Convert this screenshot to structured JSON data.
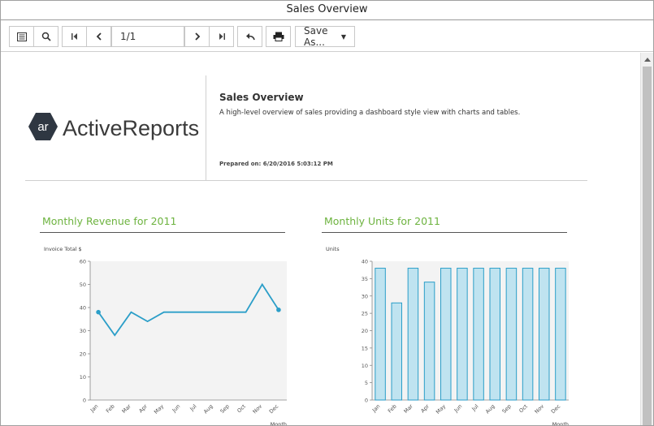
{
  "window": {
    "title": "Sales Overview"
  },
  "toolbar": {
    "page_value": "1/1",
    "save_as_label": "Save As..."
  },
  "report": {
    "logo_badge": "ar",
    "logo_text": "ActiveReports",
    "title": "Sales Overview",
    "description": "A high-level overview of sales providing a dashboard style view with charts and tables.",
    "prepared": "Prepared on: 6/20/2016 5:03:12 PM"
  },
  "colors": {
    "accent_green": "#6db33f",
    "series_blue": "#2b9ec8",
    "bar_fill": "#bfe3f0",
    "plot_bg": "#f3f3f3"
  },
  "chart_data": [
    {
      "type": "line",
      "title": "Monthly Revenue for 2011",
      "ylabel": "Invoice Total $",
      "xlabel": "Month",
      "categories": [
        "Jan",
        "Feb",
        "Mar",
        "Apr",
        "May",
        "Jun",
        "Jul",
        "Aug",
        "Sep",
        "Oct",
        "Nov",
        "Dec"
      ],
      "values": [
        38,
        28,
        38,
        34,
        38,
        38,
        38,
        38,
        38,
        38,
        50,
        39
      ],
      "yticks": [
        0,
        10,
        20,
        30,
        40,
        50,
        60
      ],
      "ylim": [
        0,
        60
      ],
      "grid": false
    },
    {
      "type": "bar",
      "title": "Monthly Units for 2011",
      "ylabel": "Units",
      "xlabel": "Month",
      "categories": [
        "Jan",
        "Feb",
        "Mar",
        "Apr",
        "May",
        "Jun",
        "Jul",
        "Aug",
        "Sep",
        "Oct",
        "Nov",
        "Dec"
      ],
      "values": [
        38,
        28,
        38,
        34,
        38,
        38,
        38,
        38,
        38,
        38,
        38,
        38
      ],
      "yticks": [
        0,
        5,
        10,
        15,
        20,
        25,
        30,
        35,
        40
      ],
      "ylim": [
        0,
        40
      ],
      "grid": false
    }
  ]
}
